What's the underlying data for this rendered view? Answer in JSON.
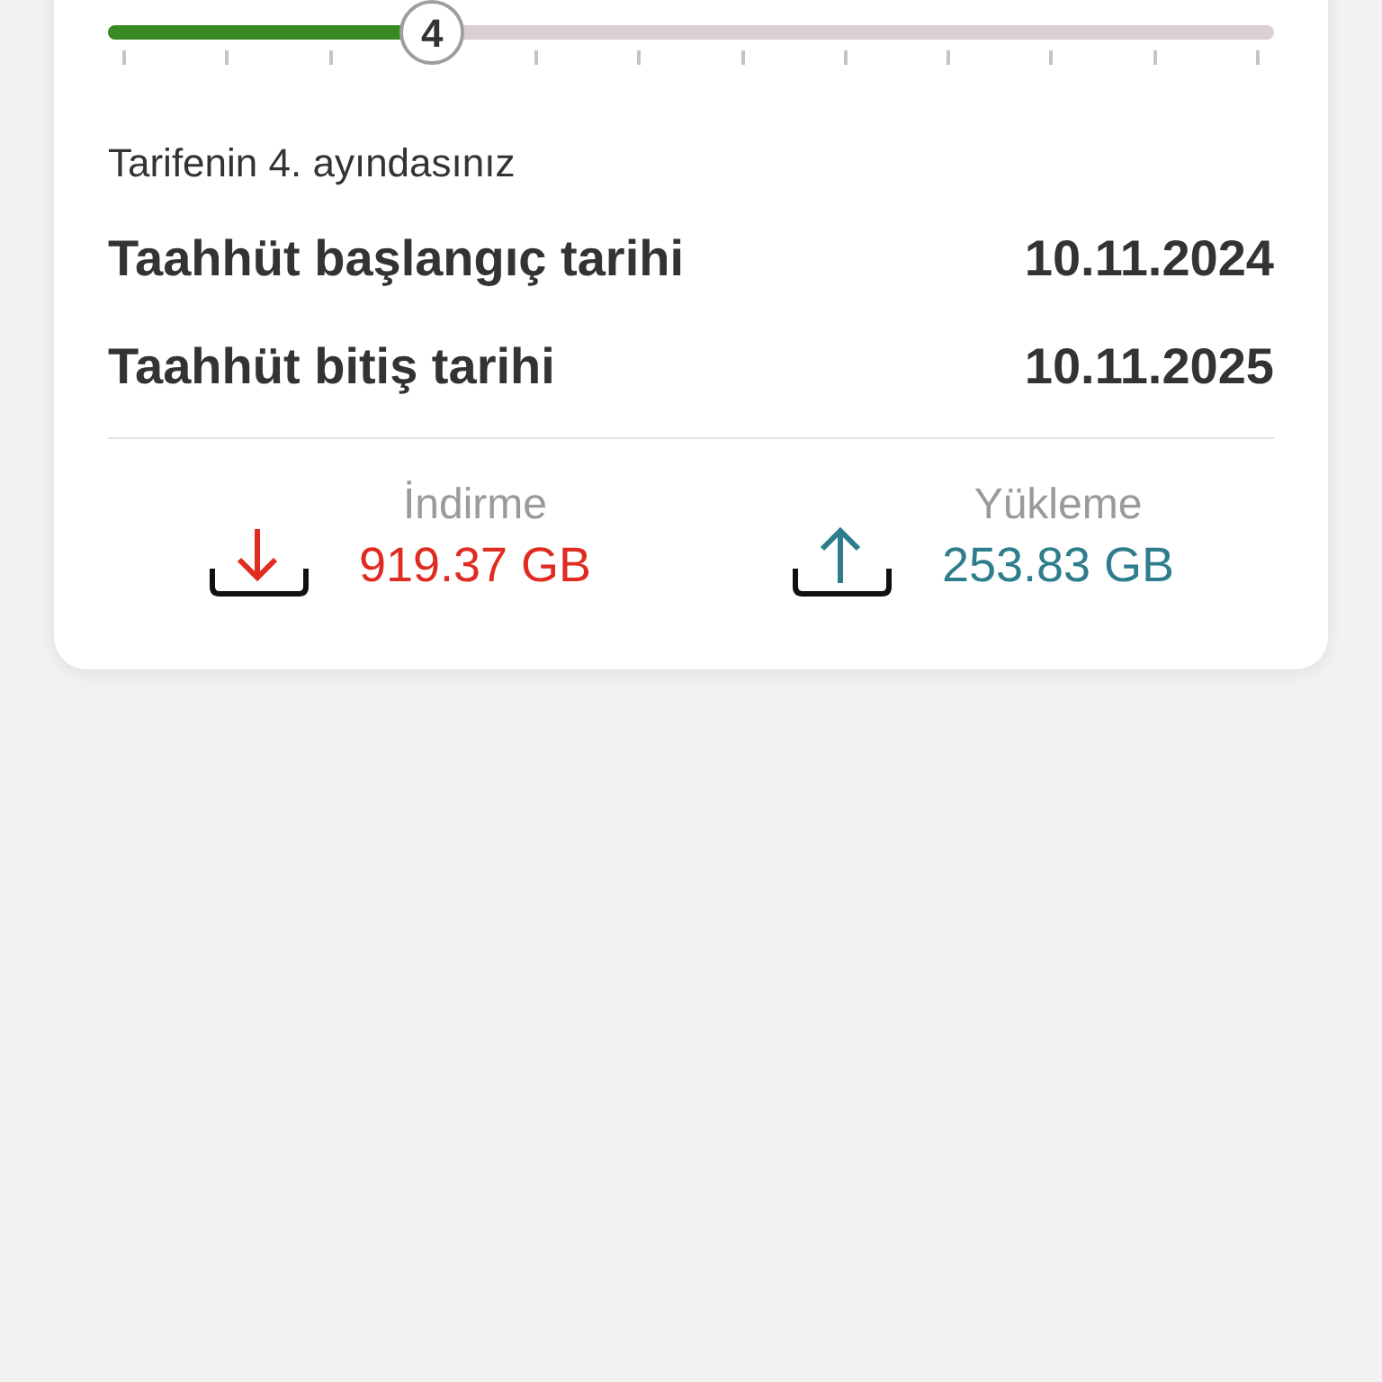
{
  "progress": {
    "level": 0.278,
    "thumb_label": "4"
  },
  "month_note": "Tarifenin 4. ayındasınız",
  "dates": [
    {
      "label": "Taahhüt başlangıç tarihi",
      "value": "10.11.2024"
    },
    {
      "label": "Taahhüt bitiş tarihi",
      "value": "10.11.2025"
    }
  ],
  "usage": [
    {
      "kind": "download",
      "label": "İndirme",
      "value": "919.37 GB"
    },
    {
      "kind": "upload",
      "label": "Yükleme",
      "value": "253.83 GB"
    }
  ]
}
